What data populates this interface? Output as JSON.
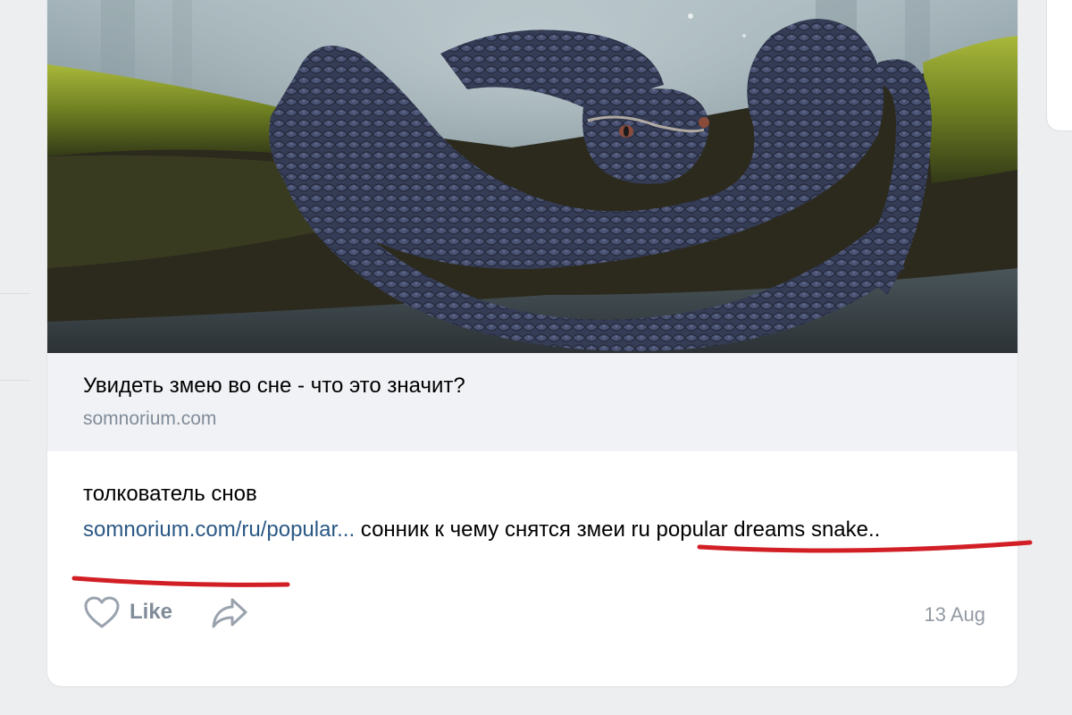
{
  "link_snippet": {
    "title": "Увидеть змею во сне - что это значит?",
    "domain": "somnorium.com"
  },
  "post": {
    "line1": "толкователь снов",
    "link_text": "somnorium.com/ru/popular...",
    "description_text": " сонник к чему снятся змеи ru popular dreams snake.."
  },
  "actions": {
    "like_label": "Like",
    "like_icon": "heart-icon",
    "share_icon": "share-arrow-icon",
    "date": "13 Aug"
  },
  "colors": {
    "link": "#2a5885",
    "muted": "#818c99",
    "annotation": "#d21f26",
    "snippet_bg": "#f0f2f5"
  }
}
